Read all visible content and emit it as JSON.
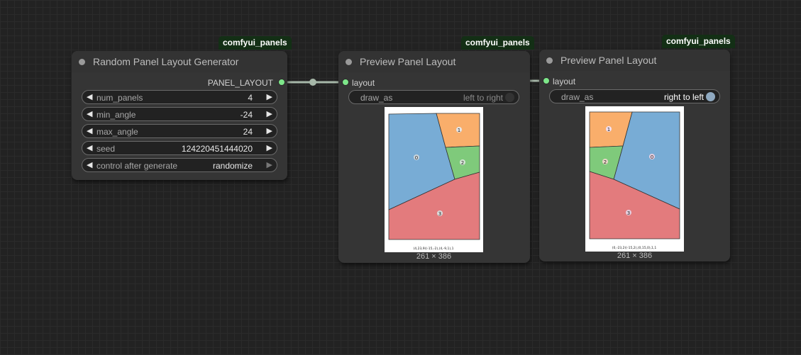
{
  "colors": {
    "canvas_bg": "#222222",
    "node_bg": "#353535",
    "badge_bg": "#132f15",
    "slot_green": "#7ee78a",
    "link": "#a7b8a9",
    "panel_blue": "#78acd5",
    "panel_orange": "#f9ae6b",
    "panel_green": "#7fca7b",
    "panel_red": "#e37b7d"
  },
  "nodes": [
    {
      "badge": "comfyui_panels",
      "title": "Random Panel Layout Generator",
      "output": "PANEL_LAYOUT",
      "widgets": [
        {
          "name": "num_panels",
          "value": "4"
        },
        {
          "name": "min_angle",
          "value": "-24"
        },
        {
          "name": "max_angle",
          "value": "24"
        },
        {
          "name": "seed",
          "value": "124220451444020"
        },
        {
          "name": "control after generate",
          "value": "randomize"
        }
      ]
    },
    {
      "badge": "comfyui_panels",
      "title": "Preview Panel Layout",
      "input": "layout",
      "toggle": {
        "name": "draw_as",
        "value": "left to right",
        "on": false
      },
      "image": {
        "panel_labels": [
          "0",
          "1",
          "2",
          "3"
        ],
        "footer": "(4,23,9)(-15,-2),(4,-9,1),1",
        "caption": "261 × 386"
      }
    },
    {
      "badge": "comfyui_panels",
      "title": "Preview Panel Layout",
      "input": "layout",
      "toggle": {
        "name": "draw_as",
        "value": "right to left",
        "on": true
      },
      "image": {
        "panel_labels": [
          "0",
          "1",
          "2",
          "3"
        ],
        "footer": "(0,-23,2)(-15,2),(0,15,0),1,1",
        "caption": "261 × 386"
      }
    }
  ]
}
